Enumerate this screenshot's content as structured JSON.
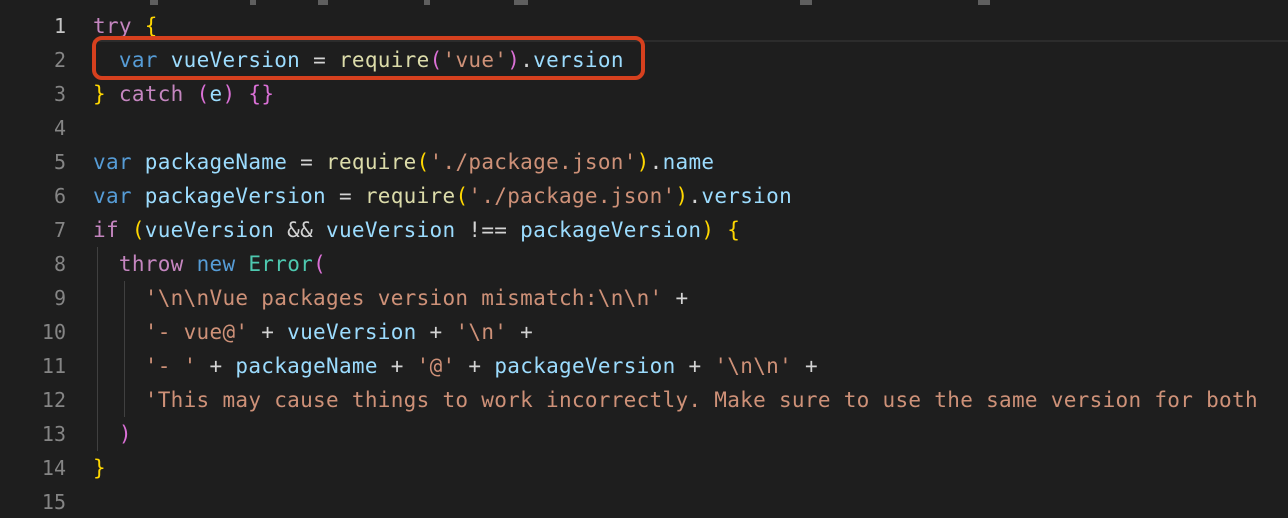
{
  "editor": {
    "lines": [
      {
        "number": "1",
        "tokens": [
          [
            "ctl",
            "try"
          ],
          [
            "op",
            " "
          ],
          [
            "br",
            "{"
          ]
        ]
      },
      {
        "number": "2",
        "tokens": [
          [
            "op",
            "  "
          ],
          [
            "kw",
            "var"
          ],
          [
            "op",
            " "
          ],
          [
            "vr",
            "vueVersion"
          ],
          [
            "op",
            " = "
          ],
          [
            "fn",
            "require"
          ],
          [
            "br2",
            "("
          ],
          [
            "str",
            "'vue'"
          ],
          [
            "br2",
            ")"
          ],
          [
            "op",
            "."
          ],
          [
            "vr",
            "version"
          ]
        ]
      },
      {
        "number": "3",
        "tokens": [
          [
            "br",
            "}"
          ],
          [
            "op",
            " "
          ],
          [
            "ctl",
            "catch"
          ],
          [
            "op",
            " "
          ],
          [
            "br2",
            "("
          ],
          [
            "vr",
            "e"
          ],
          [
            "br2",
            ")"
          ],
          [
            "op",
            " "
          ],
          [
            "br2",
            "{}"
          ]
        ]
      },
      {
        "number": "4",
        "tokens": []
      },
      {
        "number": "5",
        "tokens": [
          [
            "kw",
            "var"
          ],
          [
            "op",
            " "
          ],
          [
            "vr",
            "packageName"
          ],
          [
            "op",
            " = "
          ],
          [
            "fn",
            "require"
          ],
          [
            "br",
            "("
          ],
          [
            "str",
            "'./package.json'"
          ],
          [
            "br",
            ")"
          ],
          [
            "op",
            "."
          ],
          [
            "vr",
            "name"
          ]
        ]
      },
      {
        "number": "6",
        "tokens": [
          [
            "kw",
            "var"
          ],
          [
            "op",
            " "
          ],
          [
            "vr",
            "packageVersion"
          ],
          [
            "op",
            " = "
          ],
          [
            "fn",
            "require"
          ],
          [
            "br",
            "("
          ],
          [
            "str",
            "'./package.json'"
          ],
          [
            "br",
            ")"
          ],
          [
            "op",
            "."
          ],
          [
            "vr",
            "version"
          ]
        ]
      },
      {
        "number": "7",
        "tokens": [
          [
            "ctl",
            "if"
          ],
          [
            "op",
            " "
          ],
          [
            "br",
            "("
          ],
          [
            "vr",
            "vueVersion"
          ],
          [
            "op",
            " && "
          ],
          [
            "vr",
            "vueVersion"
          ],
          [
            "op",
            " !== "
          ],
          [
            "vr",
            "packageVersion"
          ],
          [
            "br",
            ")"
          ],
          [
            "op",
            " "
          ],
          [
            "br",
            "{"
          ]
        ]
      },
      {
        "number": "8",
        "tokens": [
          [
            "op",
            "  "
          ],
          [
            "ctl",
            "throw"
          ],
          [
            "op",
            " "
          ],
          [
            "kw",
            "new"
          ],
          [
            "op",
            " "
          ],
          [
            "cls",
            "Error"
          ],
          [
            "br2",
            "("
          ]
        ]
      },
      {
        "number": "9",
        "tokens": [
          [
            "op",
            "    "
          ],
          [
            "str",
            "'\\n\\nVue packages version mismatch:\\n\\n'"
          ],
          [
            "op",
            " +"
          ]
        ]
      },
      {
        "number": "10",
        "tokens": [
          [
            "op",
            "    "
          ],
          [
            "str",
            "'- vue@'"
          ],
          [
            "op",
            " + "
          ],
          [
            "vr",
            "vueVersion"
          ],
          [
            "op",
            " + "
          ],
          [
            "str",
            "'\\n'"
          ],
          [
            "op",
            " +"
          ]
        ]
      },
      {
        "number": "11",
        "tokens": [
          [
            "op",
            "    "
          ],
          [
            "str",
            "'- '"
          ],
          [
            "op",
            " + "
          ],
          [
            "vr",
            "packageName"
          ],
          [
            "op",
            " + "
          ],
          [
            "str",
            "'@'"
          ],
          [
            "op",
            " + "
          ],
          [
            "vr",
            "packageVersion"
          ],
          [
            "op",
            " + "
          ],
          [
            "str",
            "'\\n\\n'"
          ],
          [
            "op",
            " +"
          ]
        ]
      },
      {
        "number": "12",
        "tokens": [
          [
            "op",
            "    "
          ],
          [
            "str",
            "'This may cause things to work incorrectly. Make sure to use the same version for both"
          ]
        ]
      },
      {
        "number": "13",
        "tokens": [
          [
            "op",
            "  "
          ],
          [
            "br2",
            ")"
          ]
        ]
      },
      {
        "number": "14",
        "tokens": [
          [
            "br",
            "}"
          ]
        ]
      },
      {
        "number": "15",
        "tokens": []
      }
    ],
    "active_line": "1",
    "highlighted_line": "2"
  },
  "colors": {
    "background": "#1e1e1e",
    "highlight_border": "#d6401e"
  }
}
